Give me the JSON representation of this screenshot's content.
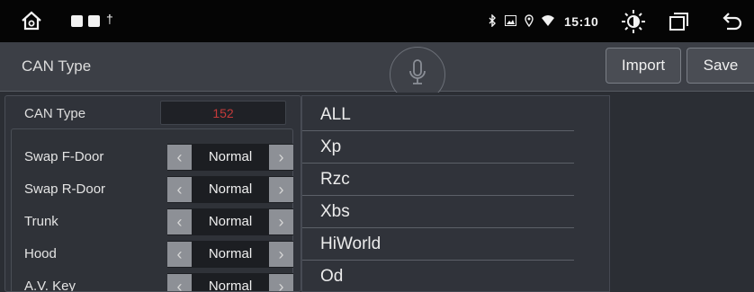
{
  "statusbar": {
    "icons": [
      "home-icon",
      "app-square-icon",
      "app-square-icon",
      "usb-icon",
      "bluetooth-icon",
      "image-icon",
      "location-icon",
      "wifi-icon",
      "brightness-icon",
      "recent-apps-icon",
      "back-icon"
    ],
    "time": "15:10"
  },
  "header": {
    "title": "CAN Type",
    "import_label": "Import",
    "save_label": "Save"
  },
  "can_type": {
    "label": "CAN Type",
    "value": "152",
    "value_color": "#c53a3a"
  },
  "settings": [
    {
      "label": "Swap F-Door",
      "value": "Normal"
    },
    {
      "label": "Swap R-Door",
      "value": "Normal"
    },
    {
      "label": "Trunk",
      "value": "Normal"
    },
    {
      "label": "Hood",
      "value": "Normal"
    },
    {
      "label": "A.V. Key",
      "value": "Normal"
    }
  ],
  "can_list": [
    "ALL",
    "Xp",
    "Rzc",
    "Xbs",
    "HiWorld",
    "Od"
  ]
}
